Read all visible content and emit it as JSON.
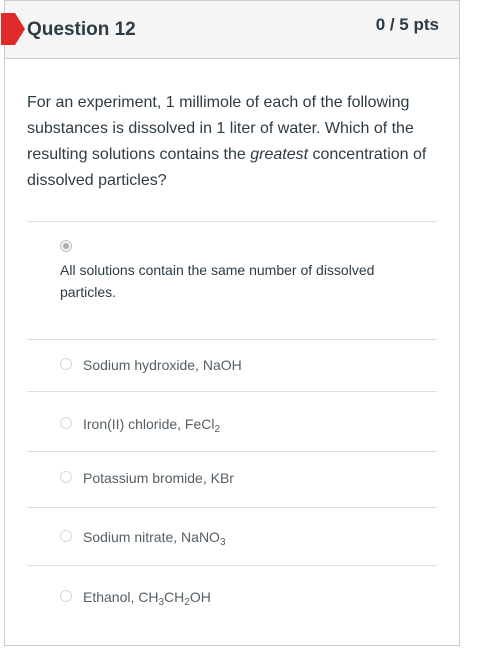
{
  "question": {
    "title": "Question 12",
    "points": "0 / 5 pts",
    "text_part1": "For an experiment, 1 millimole of each of the following substances is dissolved in 1 liter of water. Which of the resulting solutions contains the ",
    "text_emphasis": "greatest",
    "text_part2": " concentration of dissolved particles?"
  },
  "selected_answer": "All solutions contain the same number of dissolved particles.",
  "options": [
    {
      "prefix": "Sodium hydroxide, NaOH"
    },
    {
      "prefix": "Iron(II) chloride, FeCl",
      "sub1": "2"
    },
    {
      "prefix": "Potassium bromide, KBr"
    },
    {
      "prefix": "Sodium nitrate, NaNO",
      "sub1": "3"
    },
    {
      "prefix": "Ethanol, CH",
      "sub1": "3",
      "mid": "CH",
      "sub2": "2",
      "suffix": "OH"
    }
  ],
  "colors": {
    "flag": "#e02a2a",
    "header_bg": "#f5f5f5",
    "text": "#2d3b45",
    "border": "#c7cdd1"
  },
  "icons": {
    "flag": "flag-icon",
    "radio": "radio-icon"
  }
}
